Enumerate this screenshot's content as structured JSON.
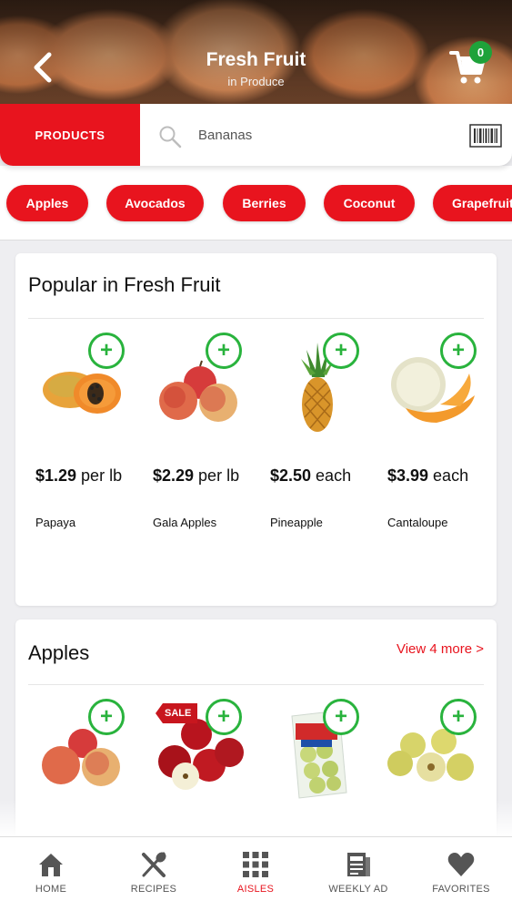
{
  "header": {
    "title": "Fresh Fruit",
    "subtitle": "in Produce",
    "cart_count": "0"
  },
  "search": {
    "tab_label": "PRODUCTS",
    "placeholder": "Bananas"
  },
  "chips": [
    "Apples",
    "Avocados",
    "Berries",
    "Coconut",
    "Grapefruit"
  ],
  "popular": {
    "title": "Popular in Fresh Fruit",
    "items": [
      {
        "price": "$1.29",
        "unit": " per lb",
        "name": "Papaya",
        "icon": "papaya-image"
      },
      {
        "price": "$2.29",
        "unit": " per lb",
        "name": "Gala Apples",
        "icon": "gala-apples-image"
      },
      {
        "price": "$2.50",
        "unit": " each",
        "name": "Pineapple",
        "icon": "pineapple-image"
      },
      {
        "price": "$3.99",
        "unit": " each",
        "name": "Cantaloupe",
        "icon": "cantaloupe-image"
      }
    ]
  },
  "apples": {
    "title": "Apples",
    "view_more": "View 4 more >",
    "sale_badge": "SALE"
  },
  "nav": {
    "items": [
      {
        "label": "HOME",
        "icon": "home-icon"
      },
      {
        "label": "RECIPES",
        "icon": "recipes-icon"
      },
      {
        "label": "AISLES",
        "icon": "aisles-icon"
      },
      {
        "label": "WEEKLY AD",
        "icon": "weekly-ad-icon"
      },
      {
        "label": "FAVORITES",
        "icon": "favorites-icon"
      }
    ],
    "active": "AISLES"
  },
  "colors": {
    "brand_red": "#e8141e",
    "add_green": "#29b33d",
    "badge_green": "#1ea23a"
  }
}
